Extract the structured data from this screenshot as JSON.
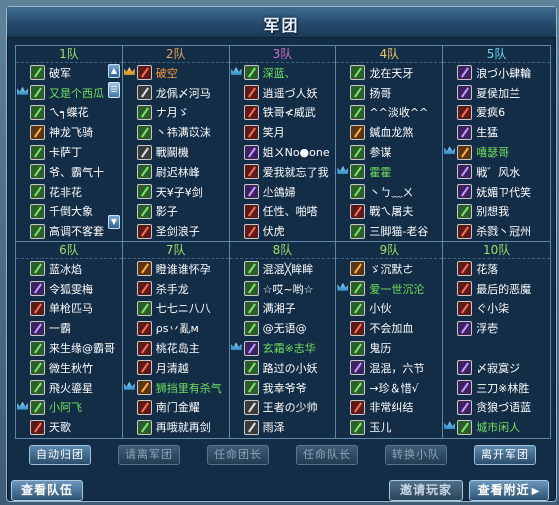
{
  "window": {
    "title": "军团",
    "close_icon": "close-icon"
  },
  "squads": [
    {
      "label": "1队",
      "color": "green",
      "members": [
        {
          "name": "破军",
          "lead": "",
          "icon": "green",
          "nc": ""
        },
        {
          "name": "又是个西瓜",
          "lead": "blue",
          "icon": "green",
          "nc": "green"
        },
        {
          "name": "ㄟ┑蝶花",
          "lead": "",
          "icon": "green",
          "nc": ""
        },
        {
          "name": "神龙飞骑",
          "lead": "",
          "icon": "orange",
          "nc": ""
        },
        {
          "name": "卡萨丁",
          "lead": "",
          "icon": "green",
          "nc": ""
        },
        {
          "name": "爷、霸气十",
          "lead": "",
          "icon": "green",
          "nc": ""
        },
        {
          "name": "花非花",
          "lead": "",
          "icon": "green",
          "nc": ""
        },
        {
          "name": "千倒大象",
          "lead": "",
          "icon": "green",
          "nc": ""
        },
        {
          "name": "高调不客套",
          "lead": "",
          "icon": "green",
          "nc": ""
        }
      ]
    },
    {
      "label": "2队",
      "color": "red",
      "members": [
        {
          "name": "破空",
          "lead": "gold",
          "icon": "red",
          "nc": "orange"
        },
        {
          "name": "龙佩〆河马",
          "lead": "",
          "icon": "",
          "nc": ""
        },
        {
          "name": "ナ月ゞ",
          "lead": "",
          "icon": "green",
          "nc": ""
        },
        {
          "name": "丶祎满苡沫",
          "lead": "",
          "icon": "green",
          "nc": ""
        },
        {
          "name": "戰鬬機",
          "lead": "",
          "icon": "",
          "nc": ""
        },
        {
          "name": "尉迟林峰",
          "lead": "",
          "icon": "green",
          "nc": ""
        },
        {
          "name": "天¥子¥剑",
          "lead": "",
          "icon": "green",
          "nc": ""
        },
        {
          "name": "影子",
          "lead": "",
          "icon": "green",
          "nc": ""
        },
        {
          "name": "圣剑浪子",
          "lead": "",
          "icon": "red",
          "nc": ""
        }
      ]
    },
    {
      "label": "3队",
      "color": "purple",
      "members": [
        {
          "name": "深蓝、",
          "lead": "blue",
          "icon": "green",
          "nc": "green"
        },
        {
          "name": "逍遥づ人妖",
          "lead": "",
          "icon": "red",
          "nc": ""
        },
        {
          "name": "铁哥≮威武",
          "lead": "",
          "icon": "red",
          "nc": ""
        },
        {
          "name": "笑月",
          "lead": "",
          "icon": "red",
          "nc": ""
        },
        {
          "name": "姐ㄨNo●one",
          "lead": "",
          "icon": "purple",
          "nc": ""
        },
        {
          "name": "爱我就忘了我",
          "lead": "",
          "icon": "red",
          "nc": ""
        },
        {
          "name": "尐鴿婦",
          "lead": "",
          "icon": "purple",
          "nc": ""
        },
        {
          "name": "任性、啪嗒",
          "lead": "",
          "icon": "red",
          "nc": ""
        },
        {
          "name": "伏虎",
          "lead": "",
          "icon": "red",
          "nc": ""
        }
      ]
    },
    {
      "label": "4队",
      "color": "yellow",
      "members": [
        {
          "name": "龙在天牙",
          "lead": "",
          "icon": "green",
          "nc": ""
        },
        {
          "name": "扬哥",
          "lead": "",
          "icon": "green",
          "nc": ""
        },
        {
          "name": "^^淡收^^",
          "lead": "",
          "icon": "green",
          "nc": ""
        },
        {
          "name": "鍼血龙煞",
          "lead": "",
          "icon": "orange",
          "nc": ""
        },
        {
          "name": "参谋",
          "lead": "",
          "icon": "green",
          "nc": ""
        },
        {
          "name": "霍霍",
          "lead": "blue",
          "icon": "green",
          "nc": "green"
        },
        {
          "name": "丶ㄅ﹏ㄨ",
          "lead": "",
          "icon": "green",
          "nc": ""
        },
        {
          "name": "戰ㄟ屠夫",
          "lead": "",
          "icon": "red",
          "nc": ""
        },
        {
          "name": "三脚猫-老谷",
          "lead": "",
          "icon": "green",
          "nc": ""
        }
      ]
    },
    {
      "label": "5队",
      "color": "sky",
      "members": [
        {
          "name": "浪づ小肆輪",
          "lead": "",
          "icon": "purple",
          "nc": ""
        },
        {
          "name": "夏侯加兰",
          "lead": "",
          "icon": "purple",
          "nc": ""
        },
        {
          "name": "爱疯6",
          "lead": "",
          "icon": "red",
          "nc": ""
        },
        {
          "name": "生猛",
          "lead": "",
          "icon": "purple",
          "nc": ""
        },
        {
          "name": "嘻瑟哥",
          "lead": "blue",
          "icon": "orange",
          "nc": "green"
        },
        {
          "name": "戦゛风水",
          "lead": "",
          "icon": "purple",
          "nc": ""
        },
        {
          "name": "妩媚ㄗ代笑",
          "lead": "",
          "icon": "purple",
          "nc": ""
        },
        {
          "name": "别想我",
          "lead": "",
          "icon": "green",
          "nc": ""
        },
        {
          "name": "杀戮丶冠州",
          "lead": "",
          "icon": "red",
          "nc": ""
        }
      ]
    },
    {
      "label": "6队",
      "color": "green",
      "members": [
        {
          "name": "蓝冰焰",
          "lead": "",
          "icon": "green",
          "nc": ""
        },
        {
          "name": "令狐雯梅",
          "lead": "",
          "icon": "purple",
          "nc": ""
        },
        {
          "name": "单枪匹马",
          "lead": "",
          "icon": "red",
          "nc": ""
        },
        {
          "name": "一霸",
          "lead": "",
          "icon": "purple",
          "nc": ""
        },
        {
          "name": "来生缘@霸哥",
          "lead": "",
          "icon": "green",
          "nc": ""
        },
        {
          "name": "微生秋竹",
          "lead": "",
          "icon": "green",
          "nc": ""
        },
        {
          "name": "飛火鎏星",
          "lead": "",
          "icon": "green",
          "nc": ""
        },
        {
          "name": "小阿飞",
          "lead": "blue",
          "icon": "green",
          "nc": "green"
        },
        {
          "name": "天歌",
          "lead": "",
          "icon": "red",
          "nc": ""
        }
      ]
    },
    {
      "label": "7队",
      "color": "green",
      "members": [
        {
          "name": "瞪谁谁怀孕",
          "lead": "",
          "icon": "orange",
          "nc": ""
        },
        {
          "name": "杀手龙",
          "lead": "",
          "icon": "red",
          "nc": ""
        },
        {
          "name": "七七ニ八八",
          "lead": "",
          "icon": "green",
          "nc": ""
        },
        {
          "name": "ρs丷亂м",
          "lead": "",
          "icon": "red",
          "nc": ""
        },
        {
          "name": "桃花岛主",
          "lead": "",
          "icon": "red",
          "nc": ""
        },
        {
          "name": "月清越",
          "lead": "",
          "icon": "red",
          "nc": ""
        },
        {
          "name": "狮挡里有杀气",
          "lead": "blue",
          "icon": "orange",
          "nc": "green"
        },
        {
          "name": "南门金耀",
          "lead": "",
          "icon": "red",
          "nc": ""
        },
        {
          "name": "再哦就再剑",
          "lead": "",
          "icon": "green",
          "nc": ""
        }
      ]
    },
    {
      "label": "8队",
      "color": "green",
      "members": [
        {
          "name": "混混╳眸眸",
          "lead": "",
          "icon": "green",
          "nc": ""
        },
        {
          "name": "☆哎~哟☆",
          "lead": "",
          "icon": "green",
          "nc": ""
        },
        {
          "name": "满湘子",
          "lead": "",
          "icon": "green",
          "nc": ""
        },
        {
          "name": "@无语@",
          "lead": "",
          "icon": "green",
          "nc": ""
        },
        {
          "name": "玄霜※志华",
          "lead": "blue",
          "icon": "purple",
          "nc": "green"
        },
        {
          "name": "路过の小妖",
          "lead": "",
          "icon": "green",
          "nc": ""
        },
        {
          "name": "我幸爷爷",
          "lead": "",
          "icon": "green",
          "nc": ""
        },
        {
          "name": "王者の少帅",
          "lead": "",
          "icon": "",
          "nc": ""
        },
        {
          "name": "雨泽",
          "lead": "",
          "icon": "",
          "nc": ""
        }
      ]
    },
    {
      "label": "9队",
      "color": "green",
      "members": [
        {
          "name": "ゞ沉默ㄜ",
          "lead": "",
          "icon": "orange",
          "nc": ""
        },
        {
          "name": "爱一世沉沦",
          "lead": "blue",
          "icon": "green",
          "nc": "green"
        },
        {
          "name": "小伙",
          "lead": "",
          "icon": "green",
          "nc": ""
        },
        {
          "name": "不会加血",
          "lead": "",
          "icon": "red",
          "nc": ""
        },
        {
          "name": "鬼历",
          "lead": "",
          "icon": "green",
          "nc": ""
        },
        {
          "name": "混混，六节",
          "lead": "",
          "icon": "purple",
          "nc": ""
        },
        {
          "name": "→珍＆惜√",
          "lead": "",
          "icon": "green",
          "nc": ""
        },
        {
          "name": "非常纠结",
          "lead": "",
          "icon": "red",
          "nc": ""
        },
        {
          "name": "玉儿",
          "lead": "",
          "icon": "green",
          "nc": ""
        }
      ]
    },
    {
      "label": "10队",
      "color": "green",
      "members": [
        {
          "name": "花落",
          "lead": "",
          "icon": "red",
          "nc": ""
        },
        {
          "name": "最后的恶魔",
          "lead": "",
          "icon": "red",
          "nc": ""
        },
        {
          "name": "ぐ小柒",
          "lead": "",
          "icon": "red",
          "nc": ""
        },
        {
          "name": "浮壱",
          "lead": "",
          "icon": "purple",
          "nc": ""
        },
        {
          "name": "",
          "lead": "",
          "icon": "",
          "nc": ""
        },
        {
          "name": "〆寂寞ジ",
          "lead": "",
          "icon": "purple",
          "nc": ""
        },
        {
          "name": "三刀※林胜",
          "lead": "",
          "icon": "purple",
          "nc": ""
        },
        {
          "name": "贪狼づ语蓝",
          "lead": "",
          "icon": "purple",
          "nc": ""
        },
        {
          "name": "城市闲人",
          "lead": "blue",
          "icon": "green",
          "nc": "green"
        }
      ]
    }
  ],
  "actions": {
    "auto_return": "自动归团",
    "request_legion": "请离军团",
    "appoint_chief": "任命团长",
    "appoint_captain": "任命队长",
    "switch_squad": "转换小队",
    "leave_legion": "离开军团"
  },
  "bottom": {
    "view_team": "查看队伍",
    "invite_player": "邀请玩家",
    "view_nearby": "查看附近"
  },
  "scroll": {
    "up": "▲",
    "thumb": "☰",
    "down": "▼"
  }
}
